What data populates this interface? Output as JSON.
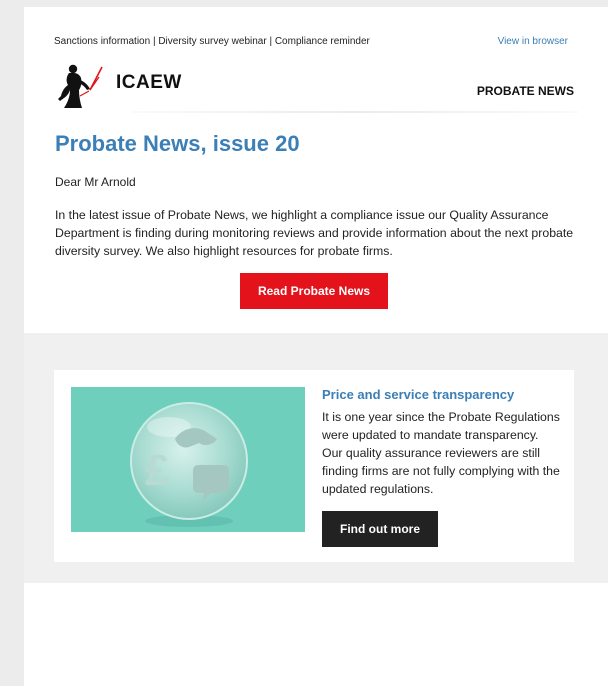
{
  "topbar": {
    "links": "Sanctions information | Diversity survey webinar | Compliance reminder",
    "view_in_browser": "View in browser"
  },
  "brand": {
    "logo_icon": "icaew-figure-logo",
    "wordmark": "ICAEW",
    "section": "PROBATE NEWS"
  },
  "main": {
    "title": "Probate News, issue 20",
    "greeting": "Dear Mr Arnold",
    "intro": "In the latest issue of Probate News, we highlight a compliance issue our Quality Assurance Department is finding during monitoring reviews and provide information about the next probate diversity survey. We also highlight resources for probate firms.",
    "cta_label": "Read Probate News"
  },
  "feature": {
    "image_icons": [
      "pound-sign-icon",
      "handshake-icon",
      "speech-bubble-icon"
    ],
    "heading": "Price and service transparency",
    "body": "It is one year since the Probate Regulations were updated to mandate transparency. Our quality assurance reviewers are still finding firms are not fully complying with the updated regulations.",
    "button_label": "Find out more"
  },
  "colors": {
    "accent_blue": "#3b7fb6",
    "cta_red": "#e3121b",
    "button_dark": "#222222",
    "image_teal": "#6fcfbd",
    "band_grey": "#f0f0f0"
  }
}
